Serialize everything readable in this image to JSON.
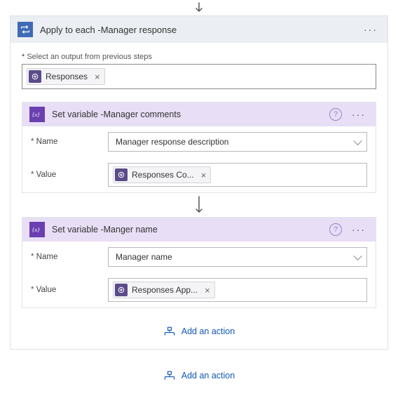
{
  "arrow_top": true,
  "outer": {
    "title": "Apply to each -Manager response",
    "dots": "···",
    "output_label": "Select an output from previous steps",
    "output_token": {
      "icon": "connector",
      "label": "Responses",
      "close": "×"
    }
  },
  "cards": [
    {
      "title": "Set variable -Manager comments",
      "help": "?",
      "dots": "···",
      "rows": [
        {
          "label": "Name",
          "type": "select",
          "value": "Manager response description"
        },
        {
          "label": "Value",
          "type": "token",
          "token": {
            "icon": "connector",
            "label": "Responses Co...",
            "close": "×"
          }
        }
      ]
    },
    {
      "title": "Set variable -Manger name",
      "help": "?",
      "dots": "···",
      "rows": [
        {
          "label": "Name",
          "type": "select",
          "value": "Manager name"
        },
        {
          "label": "Value",
          "type": "token",
          "token": {
            "icon": "connector",
            "label": "Responses App...",
            "close": "×"
          }
        }
      ]
    }
  ],
  "arrow_between": true,
  "add_action_inner": "Add an action",
  "add_action_outer": "Add an action"
}
